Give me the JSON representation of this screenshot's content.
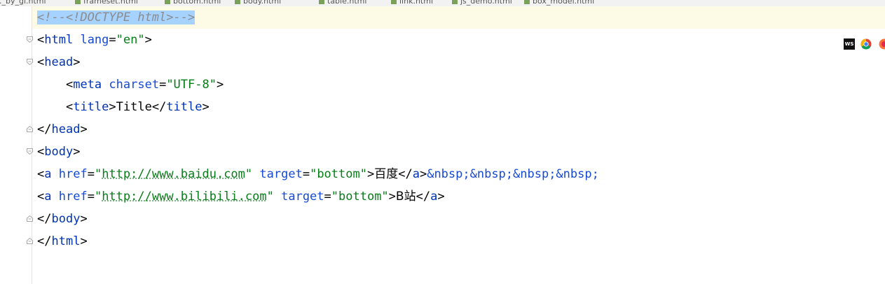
{
  "tabs": [
    {
      "label": "..._by_gi.html"
    },
    {
      "label": "frameset.html"
    },
    {
      "label": "bottom.html"
    },
    {
      "label": "body.html",
      "active": true
    },
    {
      "label": "table.html"
    },
    {
      "label": "link.html"
    },
    {
      "label": "js_demo.html"
    },
    {
      "label": "box_model.html"
    }
  ],
  "code": {
    "l1_comment": "<!--<!DOCTYPE html>-->",
    "l2": {
      "lt": "<",
      "tag": "html",
      "sp": " ",
      "attr": "lang",
      "eq": "=",
      "val": "\"en\"",
      "gt": ">"
    },
    "l3": {
      "lt": "<",
      "tag": "head",
      "gt": ">"
    },
    "l4": {
      "indent": "    ",
      "lt": "<",
      "tag": "meta",
      "sp": " ",
      "attr": "charset",
      "eq": "=",
      "val": "\"UTF-8\"",
      "gt": ">"
    },
    "l5": {
      "indent": "    ",
      "lt": "<",
      "tag": "title",
      "gt": ">",
      "text": "Title",
      "lt2": "</",
      "tag2": "title",
      "gt2": ">"
    },
    "l6": {
      "lt": "</",
      "tag": "head",
      "gt": ">"
    },
    "l7": {
      "lt": "<",
      "tag": "body",
      "gt": ">"
    },
    "l8": {
      "lt": "<",
      "tag": "a",
      "sp": " ",
      "attr": "href",
      "eq": "=",
      "q1": "\"",
      "url": "http://www.baidu.com",
      "q2": "\"",
      "sp2": " ",
      "attr2": "target",
      "eq2": "=",
      "val2": "\"bottom\"",
      "gt": ">",
      "text": "百度",
      "lt2": "</",
      "tag2": "a",
      "gt2": ">",
      "entities": "&nbsp;&nbsp;&nbsp;&nbsp;"
    },
    "l9": {
      "lt": "<",
      "tag": "a",
      "sp": " ",
      "attr": "href",
      "eq": "=",
      "q1": "\"",
      "url": "http://www.bilibili.com",
      "q2": "\"",
      "sp2": " ",
      "attr2": "target",
      "eq2": "=",
      "val2": "\"bottom\"",
      "gt": ">",
      "text": "B站",
      "lt2": "</",
      "tag2": "a",
      "gt2": ">"
    },
    "l10": {
      "lt": "</",
      "tag": "body",
      "gt": ">"
    },
    "l11": {
      "lt": "</",
      "tag": "html",
      "gt": ">"
    }
  },
  "browser_icons": [
    "webstorm-icon",
    "chrome-icon",
    "firefox-icon"
  ],
  "colors": {
    "tag": "#0033b3",
    "attr": "#174ad4",
    "string": "#067d17",
    "comment": "#8c8c8c",
    "selection": "#a6d2ff",
    "current_line": "#fdfbe6"
  }
}
